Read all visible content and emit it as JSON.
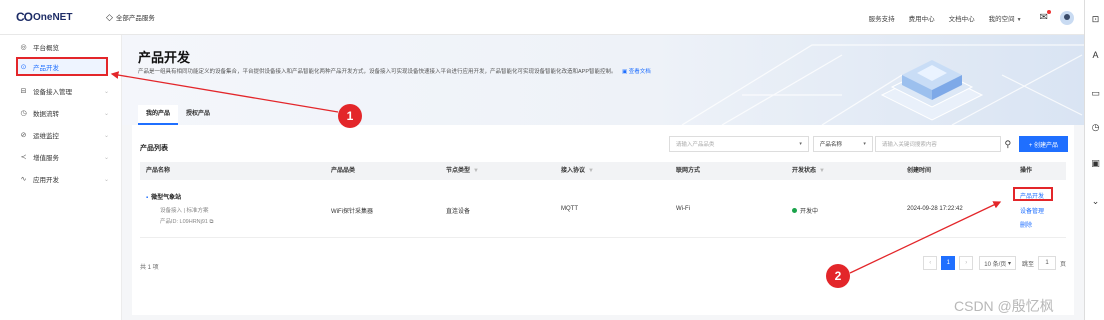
{
  "header": {
    "logo_mark": "CO",
    "logo_text": "OneNET",
    "all_services": "全部产品服务",
    "links": [
      "服务支持",
      "费用中心",
      "文档中心",
      "我的空间"
    ]
  },
  "sidebar": {
    "items": [
      {
        "label": "平台概览",
        "icon": "overview-icon"
      },
      {
        "label": "产品开发",
        "icon": "product-dev-icon"
      },
      {
        "label": "设备接入管理",
        "icon": "device-access-icon"
      },
      {
        "label": "数据流转",
        "icon": "data-flow-icon"
      },
      {
        "label": "运维监控",
        "icon": "monitor-icon"
      },
      {
        "label": "增值服务",
        "icon": "value-added-icon"
      },
      {
        "label": "应用开发",
        "icon": "app-dev-icon"
      }
    ]
  },
  "hero": {
    "title": "产品开发",
    "description": "产品是一组具有相同功能定义的设备集合，平台提供设备接入和产品智能化两种产品开发方式，设备接入可实现设备快速接入平台进行应用开发，产品智能化可实现设备智能化改造和APP智能控制。",
    "doc_link": "查看文档"
  },
  "tabs": [
    "我的产品",
    "授权产品"
  ],
  "list": {
    "title": "产品列表",
    "filter_category_placeholder": "请输入产品品类",
    "filter_field": "产品名称",
    "filter_keyword_placeholder": "请输入关键词搜索内容",
    "create_button": "+ 创建产品",
    "columns": [
      "产品名称",
      "产品品类",
      "节点类型",
      "接入协议",
      "联网方式",
      "开发状态",
      "创建时间",
      "操作"
    ],
    "rows": [
      {
        "name": "微型气象站",
        "sub1": "设备接入 | 标准方案",
        "sub2": "产品ID: L09HRNj91",
        "category": "WiFi探针采集器",
        "node_type": "直连设备",
        "protocol": "MQTT",
        "network": "Wi-Fi",
        "status": "开发中",
        "created": "2024-09-28 17:22:42",
        "actions": [
          "产品开发",
          "设备管理",
          "删除"
        ]
      }
    ],
    "total": "共 1 项",
    "page": "1",
    "page_size": "10 条/页",
    "jump_label": "跳至",
    "jump_value": "1",
    "page_unit": "页"
  },
  "annotations": {
    "badge1": "1",
    "badge2": "2"
  },
  "watermark": "CSDN @殷忆枫",
  "colors": {
    "accent": "#1f6fff",
    "annotation_red": "#e3262a",
    "status_green": "#1aa34a"
  }
}
